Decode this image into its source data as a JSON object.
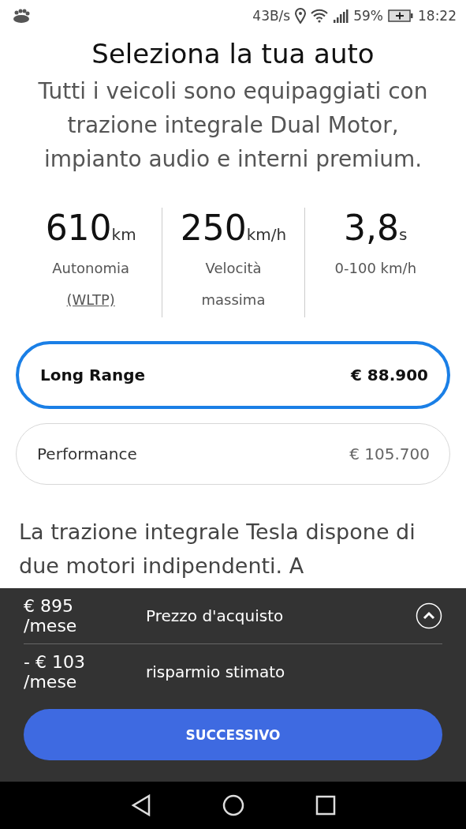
{
  "status_bar": {
    "speed": "43B/s",
    "battery": "59%",
    "time": "18:22"
  },
  "title": "Seleziona la tua auto",
  "subtitle": "Tutti i veicoli sono equipaggiati con trazione integrale Dual Motor, impianto audio e interni premium.",
  "stats": [
    {
      "value": "610",
      "unit": "km",
      "label": "Autonomia",
      "link": "(WLTP)"
    },
    {
      "value": "250",
      "unit": "km/h",
      "label": "Velocità massima"
    },
    {
      "value": "3,8",
      "unit": "s",
      "label": "0-100 km/h"
    }
  ],
  "options": [
    {
      "name": "Long Range",
      "price": "€ 88.900",
      "selected": true
    },
    {
      "name": "Performance",
      "price": "€ 105.700",
      "selected": false
    }
  ],
  "description": "La trazione integrale Tesla dispone di due motori indipendenti. A",
  "summary": {
    "expanded": true,
    "rows": [
      {
        "amount": "€ 895",
        "period": "/mese",
        "label": "Prezzo d'acquisto"
      },
      {
        "amount": "- € 103",
        "period": "/mese",
        "label": "risparmio stimato"
      }
    ],
    "button": "SUCCESSIVO"
  }
}
